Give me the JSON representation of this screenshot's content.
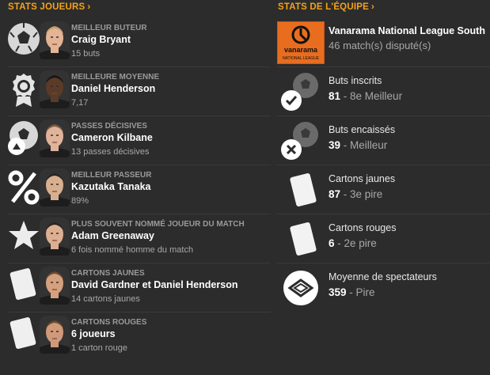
{
  "headers": {
    "players": "STATS JOUEURS",
    "team": "STATS DE L'ÉQUIPE"
  },
  "players": [
    {
      "category": "MEILLEUR BUTEUR",
      "name": "Craig Bryant",
      "value": "15 buts",
      "icon": "football-icon",
      "skin": "#e3b495",
      "hair": "#caa06a"
    },
    {
      "category": "MEILLEURE MOYENNE",
      "name": "Daniel Henderson",
      "value": "7,17",
      "icon": "award-rosette-icon",
      "skin": "#5a3a28",
      "hair": "#1a1410"
    },
    {
      "category": "PASSES DÉCISIVES",
      "name": "Cameron Kilbane",
      "value": "13 passes décisives",
      "icon": "football-assist-icon",
      "skin": "#e0b49a",
      "hair": "#7a5a40"
    },
    {
      "category": "MEILLEUR PASSEUR",
      "name": "Kazutaka Tanaka",
      "value": "89%",
      "icon": "percent-icon",
      "skin": "#d8b090",
      "hair": "#2a2420"
    },
    {
      "category": "PLUS SOUVENT NOMMÉ JOUEUR DU MATCH",
      "name": "Adam Greenaway",
      "value": "6 fois nommé homme du match",
      "icon": "star-icon",
      "skin": "#dcae92",
      "hair": "#2a2420"
    },
    {
      "category": "CARTONS JAUNES",
      "name": "David Gardner et Daniel Henderson",
      "value": "14 cartons jaunes",
      "icon": "yellow-card-icon",
      "skin": "#d4a07e",
      "hair": "#6a4a30"
    },
    {
      "category": "CARTONS ROUGES",
      "name": "6 joueurs",
      "value": "1 carton rouge",
      "icon": "red-card-icon",
      "skin": "#d09a7a",
      "hair": "#6a4a30"
    }
  ],
  "team": {
    "league": {
      "name": "Vanarama National League South",
      "sub": "46 match(s) disputé(s)",
      "logo_text": "vanarama",
      "logo_sub": "NATIONAL LEAGUE",
      "brand_color": "#e86d1f"
    },
    "stats": [
      {
        "label": "Buts inscrits",
        "value": "81",
        "rank": " - 8e Meilleur",
        "icon": "goals-scored-icon"
      },
      {
        "label": "Buts encaissés",
        "value": "39",
        "rank": " - Meilleur",
        "icon": "goals-conceded-icon"
      },
      {
        "label": "Cartons jaunes",
        "value": "87",
        "rank": " - 3e pire",
        "icon": "yellow-card-icon"
      },
      {
        "label": "Cartons rouges",
        "value": "6",
        "rank": " - 2e pire",
        "icon": "red-card-icon"
      },
      {
        "label": "Moyenne de spectateurs",
        "value": "359",
        "rank": " - Pire",
        "icon": "stadium-icon"
      }
    ]
  },
  "colors": {
    "accent": "#f5a21a",
    "background": "#2c2c2c",
    "muted": "#a8a8a8"
  }
}
